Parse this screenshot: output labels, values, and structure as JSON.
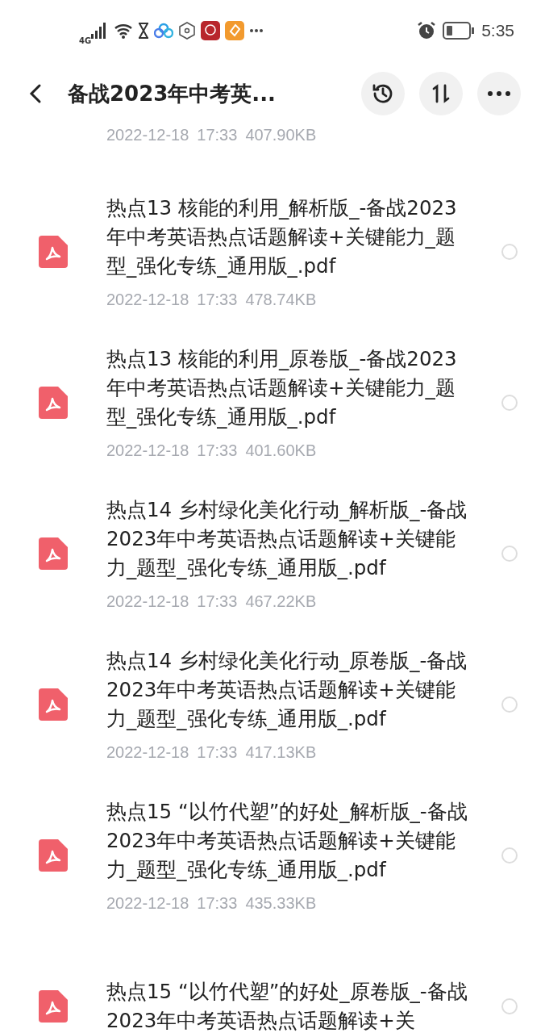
{
  "status_bar": {
    "network": "4G",
    "time": "5:35"
  },
  "header": {
    "title": "备战2023年中考英..."
  },
  "top_meta": {
    "date": "2022-12-18",
    "time": "17:33",
    "size": "407.90KB"
  },
  "files": [
    {
      "name": "热点13 核能的利用_解析版_-备战2023年中考英语热点话题解读+关键能力_题型_强化专练_通用版_.pdf",
      "date": "2022-12-18",
      "time": "17:33",
      "size": "478.74KB",
      "selected": false
    },
    {
      "name": "热点13 核能的利用_原卷版_-备战2023年中考英语热点话题解读+关键能力_题型_强化专练_通用版_.pdf",
      "date": "2022-12-18",
      "time": "17:33",
      "size": "401.60KB",
      "selected": false
    },
    {
      "name": "热点14 乡村绿化美化行动_解析版_-备战2023年中考英语热点话题解读+关键能力_题型_强化专练_通用版_.pdf",
      "date": "2022-12-18",
      "time": "17:33",
      "size": "467.22KB",
      "selected": false
    },
    {
      "name": "热点14 乡村绿化美化行动_原卷版_-备战2023年中考英语热点话题解读+关键能力_题型_强化专练_通用版_.pdf",
      "date": "2022-12-18",
      "time": "17:33",
      "size": "417.13KB",
      "selected": false
    },
    {
      "name": "热点15 “以竹代塑”的好处_解析版_-备战2023年中考英语热点话题解读+关键能力_题型_强化专练_通用版_.pdf",
      "date": "2022-12-18",
      "time": "17:33",
      "size": "435.33KB",
      "selected": false
    },
    {
      "name": "热点15 “以竹代塑”的好处_原卷版_-备战2023年中考英语热点话题解读+关",
      "selected": false
    }
  ]
}
